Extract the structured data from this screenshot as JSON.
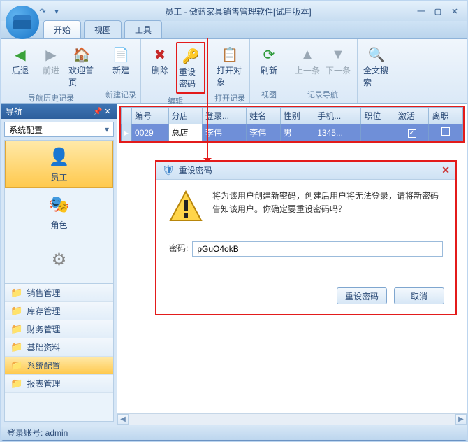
{
  "window": {
    "title": "员工 - 傲蓝家具销售管理软件[试用版本]"
  },
  "tabs": {
    "t0": "开始",
    "t1": "视图",
    "t2": "工具"
  },
  "ribbon": {
    "back": "后退",
    "forward": "前进",
    "home": "欢迎首页",
    "g_history": "导航历史记录",
    "new": "新建",
    "g_new": "新建记录",
    "delete": "删除",
    "resetpwd": "重设密码",
    "g_edit": "编辑",
    "openobj": "打开对象",
    "g_open": "打开记录",
    "refresh": "刷新",
    "g_view": "视图",
    "prev": "上一条",
    "next": "下一条",
    "g_recnav": "记录导航",
    "search": "全文搜索"
  },
  "nav": {
    "title": "导航",
    "combo": "系统配置",
    "big": {
      "emp": "员工",
      "role": "角色"
    },
    "items": {
      "i0": "销售管理",
      "i1": "库存管理",
      "i2": "财务管理",
      "i3": "基础资料",
      "i4": "系统配置",
      "i5": "报表管理"
    }
  },
  "grid": {
    "cols": {
      "c0": "编号",
      "c1": "分店",
      "c2": "登录...",
      "c3": "姓名",
      "c4": "性别",
      "c5": "手机...",
      "c6": "职位",
      "c7": "激活",
      "c8": "离职"
    },
    "row": {
      "c0": "0029",
      "c1": "总店",
      "c2": "李伟",
      "c3": "李伟",
      "c4": "男",
      "c5": "1345...",
      "c6": "",
      "c7": "✓",
      "c8": ""
    }
  },
  "dialog": {
    "title": "重设密码",
    "message": "将为该用户创建新密码，创建后用户将无法登录，请将新密码告知该用户。你确定要重设密码吗？",
    "pwd_label": "密码:",
    "pwd_value": "pGuO4okB",
    "ok": "重设密码",
    "cancel": "取消"
  },
  "status": {
    "text": "登录账号: admin"
  }
}
